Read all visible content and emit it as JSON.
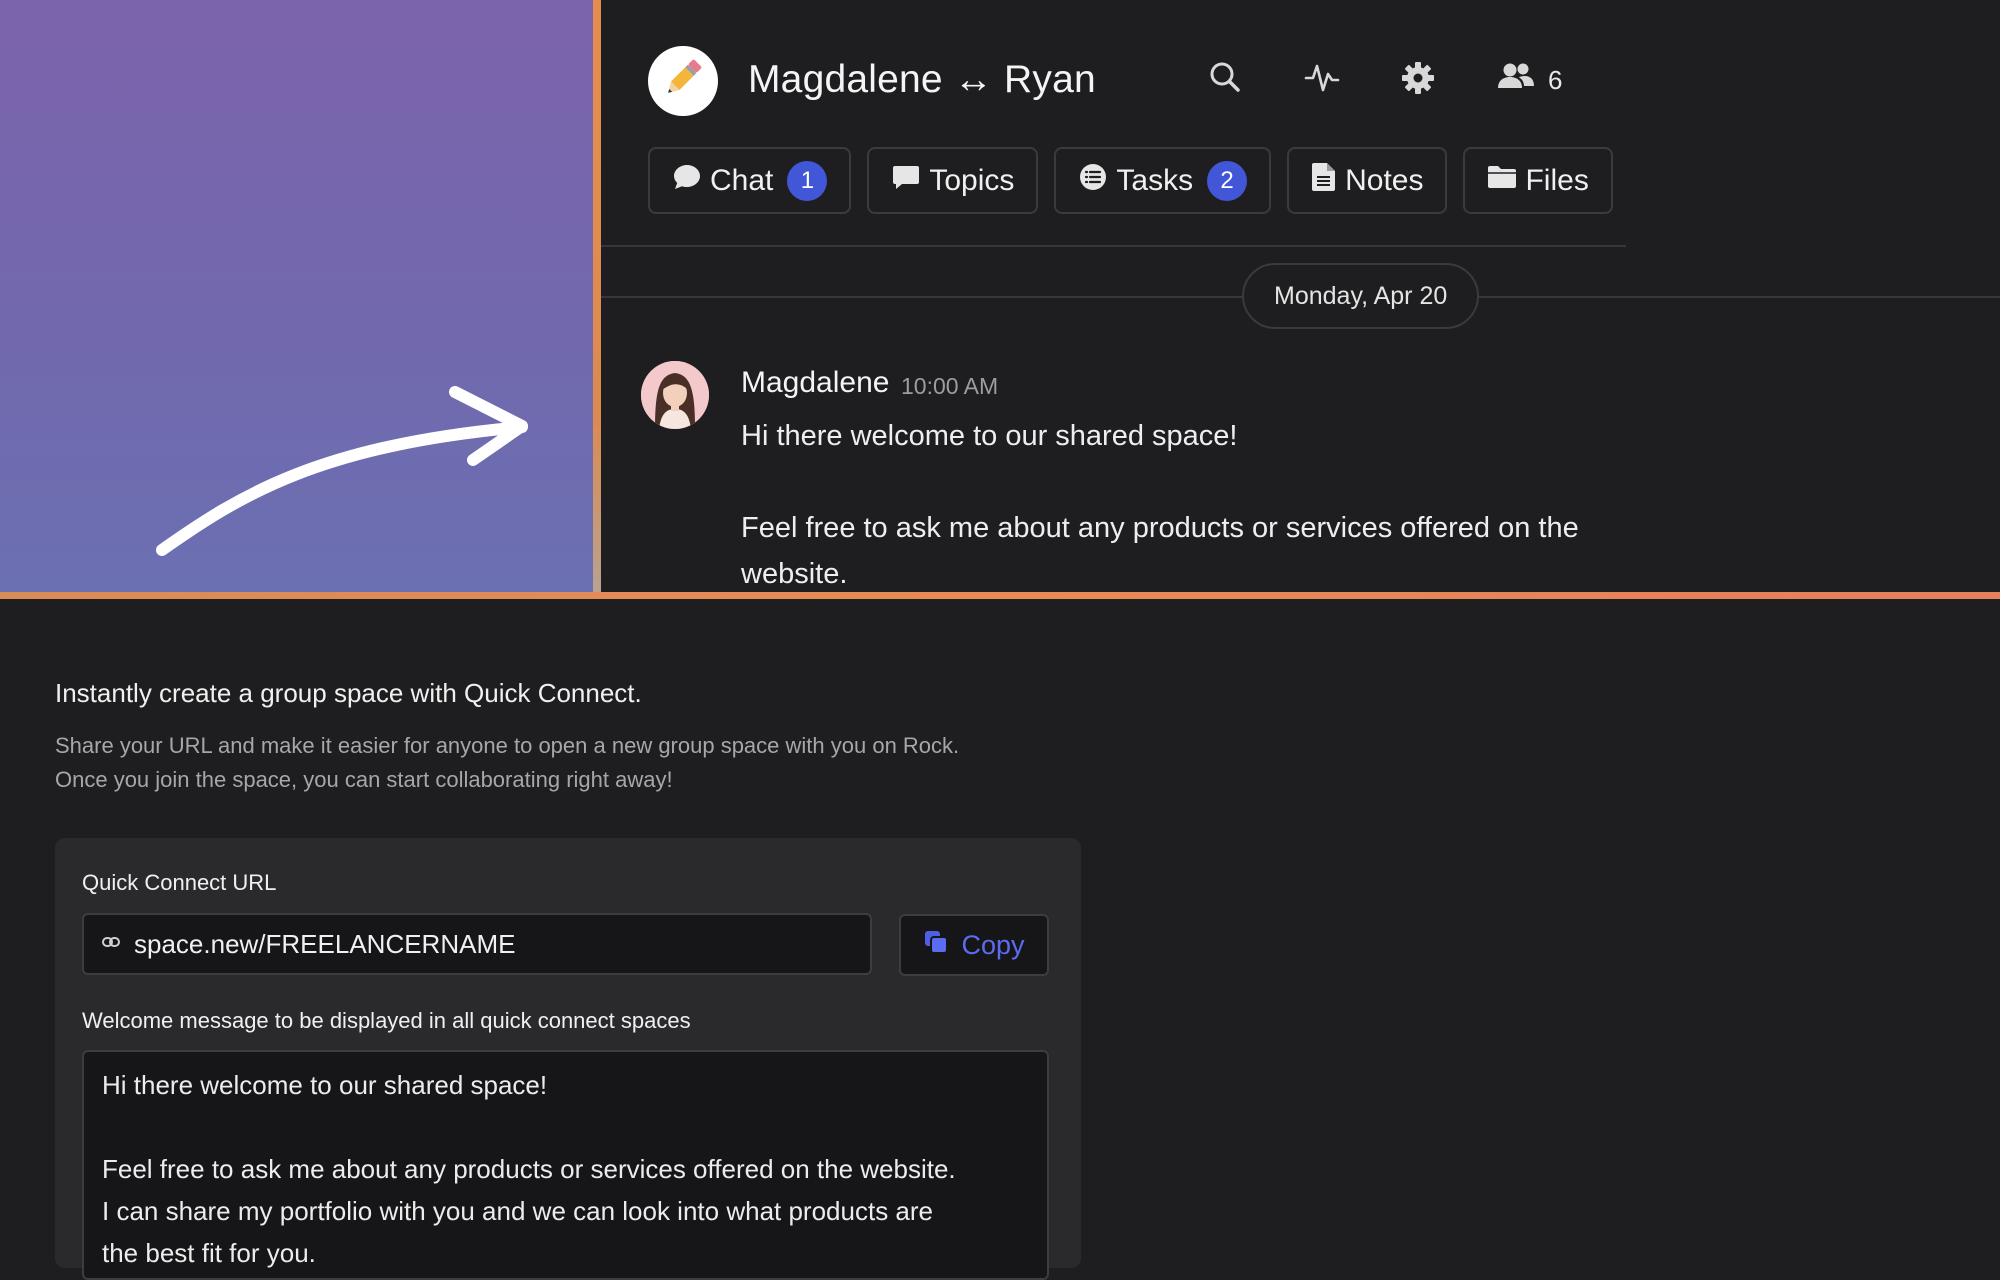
{
  "preview": {
    "space_title": "Magdalene ↔ Ryan",
    "space_avatar_icon": "pencil-icon",
    "members_count": "6",
    "tabs": [
      {
        "label": "Chat",
        "icon": "chat-bubble-icon",
        "badge": "1"
      },
      {
        "label": "Topics",
        "icon": "topic-bubble-icon",
        "badge": ""
      },
      {
        "label": "Tasks",
        "icon": "task-list-icon",
        "badge": "2"
      },
      {
        "label": "Notes",
        "icon": "note-file-icon",
        "badge": ""
      },
      {
        "label": "Files",
        "icon": "folder-icon",
        "badge": ""
      }
    ],
    "date_divider": "Monday, Apr 20",
    "message": {
      "author": "Magdalene",
      "time": "10:00 AM",
      "body": "Hi there welcome to our shared space!\n\nFeel free to ask me about any products or services offered on the website."
    }
  },
  "settings": {
    "intro_title": "Instantly create a group space with Quick Connect.",
    "intro_description": "Share your URL and make it easier for anyone to open a new group space with you on Rock. Once you join the space, you can start collaborating right away!",
    "url_label": "Quick Connect URL",
    "url_value": "space.new/FREELANCERNAME",
    "copy_label": "Copy",
    "welcome_label": "Welcome message to be displayed in all quick connect spaces",
    "welcome_message": "Hi there welcome to our shared space!\n\nFeel free to ask me about any products or services offered on the website.\nI can share my portfolio with you and we can look into what products are\n the best fit for you."
  },
  "colors": {
    "accent_blue": "#4256d8",
    "copy_blue": "#5b6cf0",
    "separator_orange": "#e58d4e",
    "background": "#1e1e20"
  }
}
